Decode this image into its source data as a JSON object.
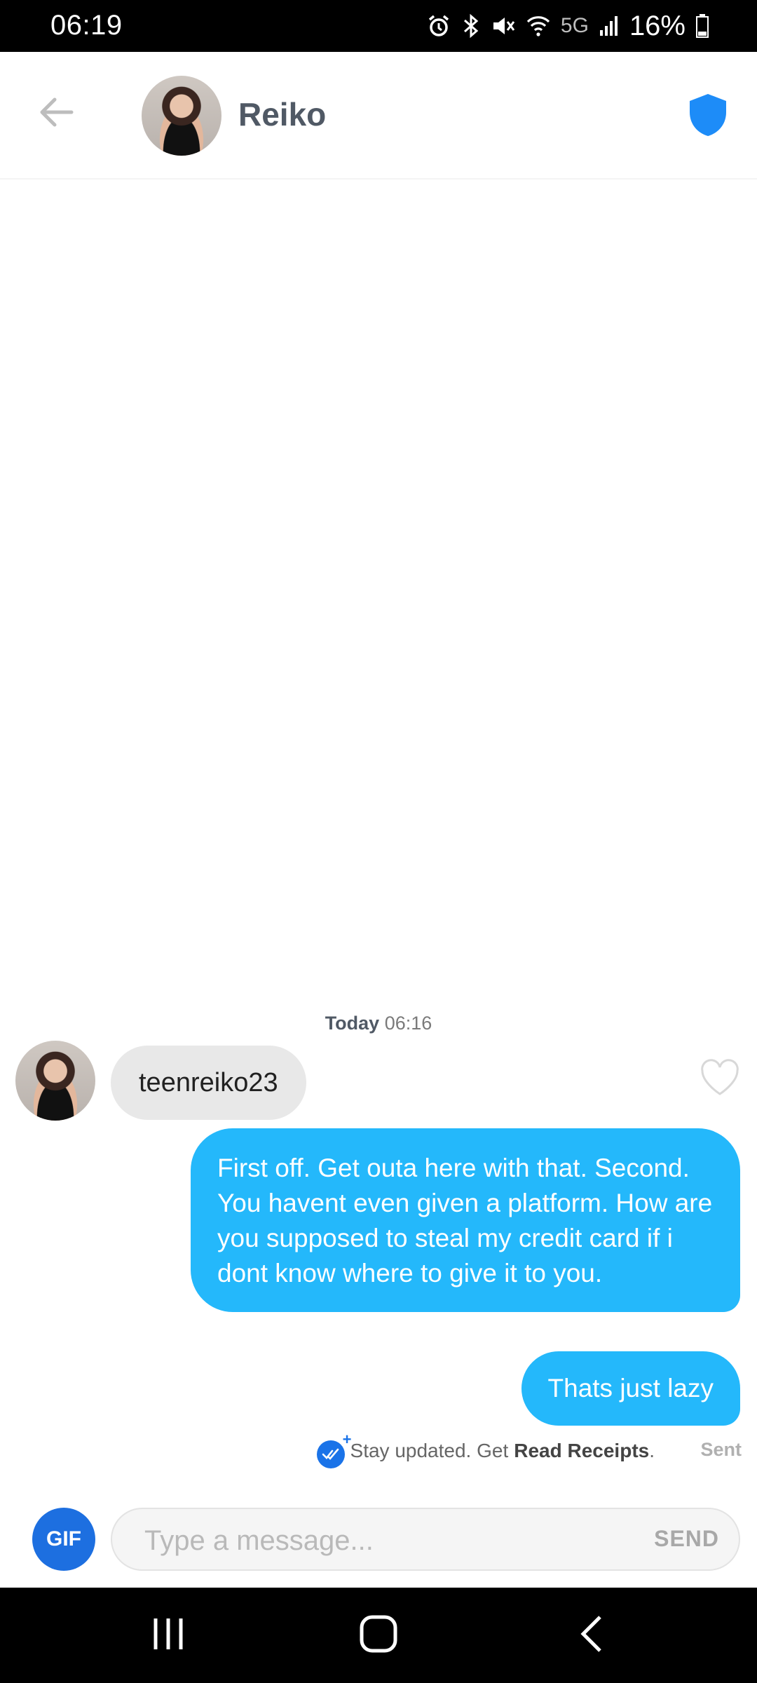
{
  "status_bar": {
    "time": "06:19",
    "network": "5G",
    "battery": "16%"
  },
  "header": {
    "contact_name": "Reiko"
  },
  "chat": {
    "timestamp_day": "Today",
    "timestamp_time": "06:16",
    "messages": [
      {
        "direction": "incoming",
        "text": "teenreiko23"
      },
      {
        "direction": "outgoing",
        "text": "First off. Get outa here with that. Second. You havent even given a platform. How are you supposed to steal my credit card if i dont know where to give it to you."
      },
      {
        "direction": "outgoing",
        "text": "Thats just lazy"
      }
    ],
    "receipts_prefix": "Stay updated. Get",
    "receipts_link": "Read Receipts",
    "receipts_suffix": ".",
    "status": "Sent"
  },
  "composer": {
    "gif_label": "GIF",
    "placeholder": "Type a message...",
    "send_label": "SEND"
  },
  "colors": {
    "outgoing_bubble": "#24b8fb",
    "incoming_bubble": "#e8e8e8",
    "shield": "#1d8cf8",
    "gif_button": "#1d6fe0"
  }
}
